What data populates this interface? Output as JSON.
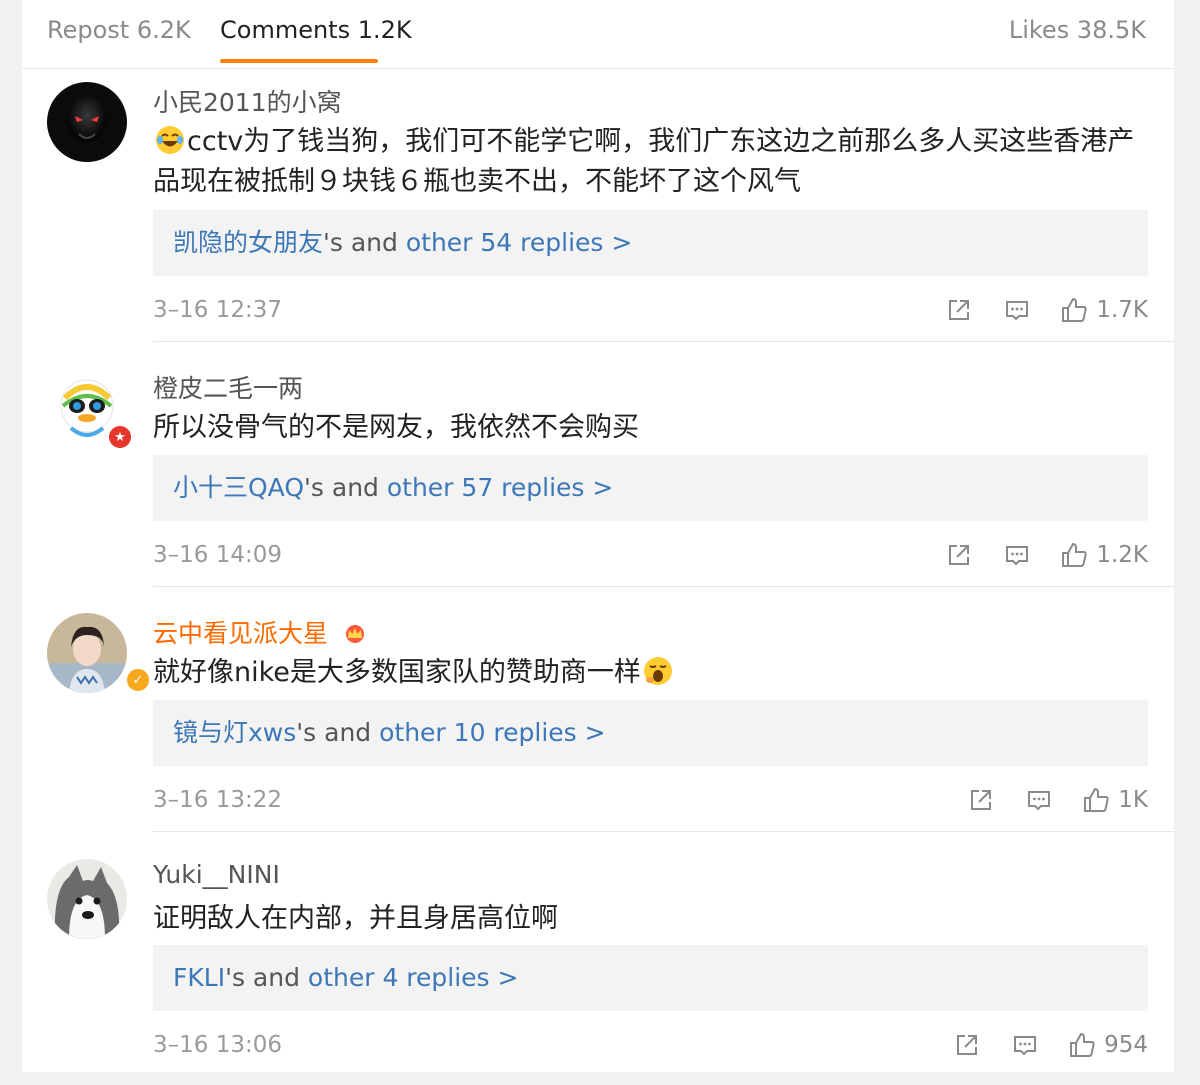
{
  "tabs": {
    "repost": "Repost 6.2K",
    "comments": "Comments 1.2K",
    "likes": "Likes 38.5K"
  },
  "accent_color": "#ff8200",
  "link_color": "#3c77b7",
  "comments": [
    {
      "username": "小民2011的小窝",
      "text": "cctv为了钱当狗，我们可不能学它啊，我们广东这边之前那么多人买这些香港产品现在被抵制９块钱６瓶也卖不出，不能坏了这个风气",
      "reply_user": "凯隐的女朋友",
      "reply_mid": "'s and ",
      "reply_tail": "other 54 replies >",
      "time": "3–16 12:37",
      "likes": "1.7K"
    },
    {
      "username": "橙皮二毛一两",
      "text": "所以没骨气的不是网友，我依然不会购买",
      "reply_user": "小十三QAQ",
      "reply_mid": "'s and ",
      "reply_tail": "other 57 replies >",
      "time": "3–16 14:09",
      "likes": "1.2K"
    },
    {
      "username": "云中看见派大星",
      "text": "就好像nike是大多数国家队的赞助商一样",
      "reply_user": "镜与灯xws",
      "reply_mid": "'s and ",
      "reply_tail": "other 10 replies >",
      "time": "3–16 13:22",
      "likes": "1K"
    },
    {
      "username": "Yuki__NINI",
      "text": "证明敌人在内部，并且身居高位啊",
      "reply_user": "FKLI",
      "reply_mid": "'s and ",
      "reply_tail": "other 4 replies >",
      "time": "3–16 13:06",
      "likes": "954"
    }
  ]
}
